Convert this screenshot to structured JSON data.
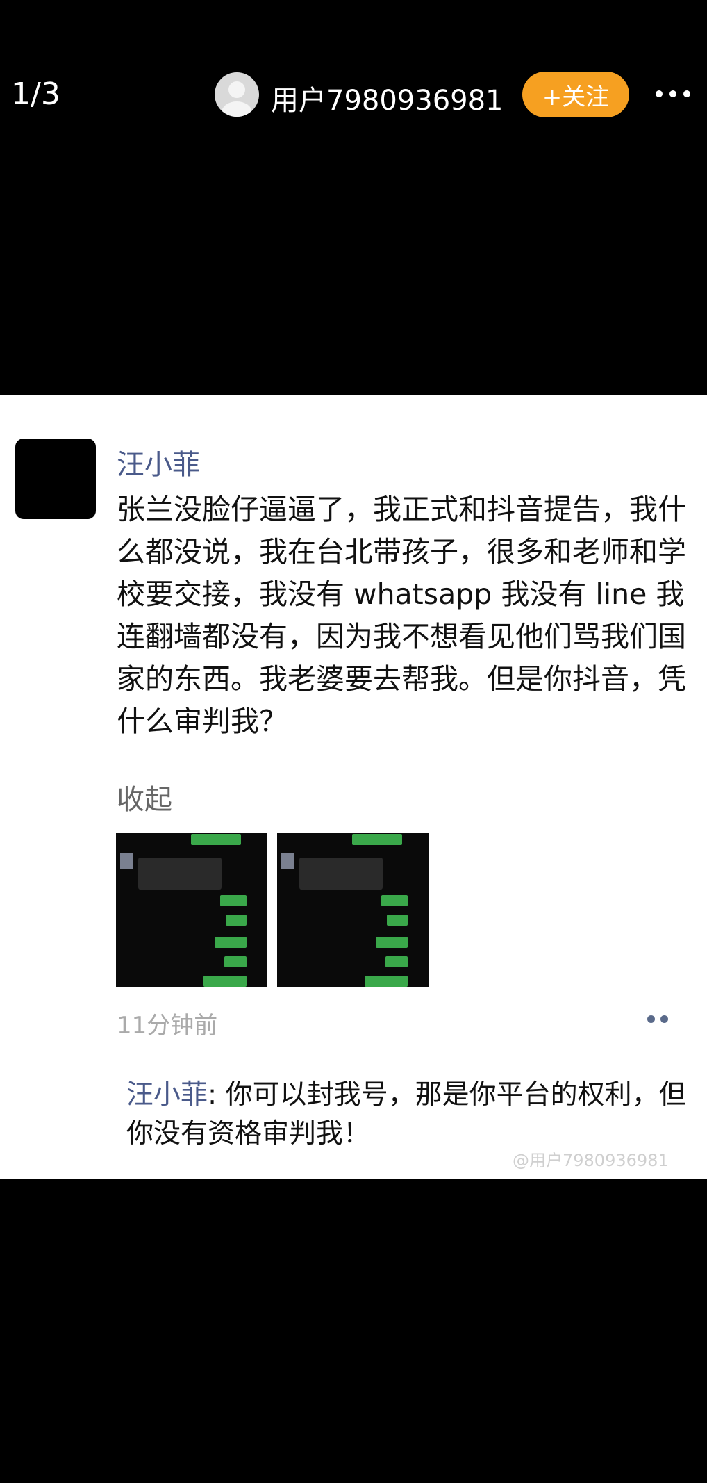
{
  "topbar": {
    "page_counter": "1/3",
    "username": "用户7980936981",
    "follow_label": "+关注"
  },
  "post": {
    "author": "汪小菲",
    "text": "张兰没脸仔逼逼了，我正式和抖音提告，我什么都没说，我在台北带孩子，很多和老师和学校要交接，我没有 whatsapp 我没有 line 我连翻墙都没有，因为我不想看见他们骂我们国家的东西。我老婆要去帮我。但是你抖音，凭什么审判我？",
    "collapse_label": "收起",
    "timestamp": "11分钟前"
  },
  "comment": {
    "author": "汪小菲",
    "separator": ": ",
    "text": "你可以封我号，那是你平台的权利，但你没有资格审判我！"
  },
  "watermark": "@用户7980936981",
  "colors": {
    "background": "#000000",
    "card": "#ffffff",
    "follow_button": "#f6a021",
    "author_name": "#4a5a8a"
  }
}
